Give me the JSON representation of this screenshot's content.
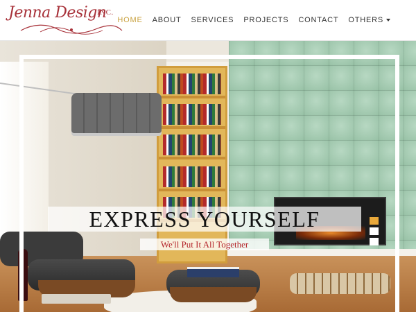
{
  "brand": {
    "name": "Jenna Design",
    "suffix": "INC."
  },
  "nav": {
    "items": [
      {
        "label": "HOME",
        "active": true
      },
      {
        "label": "ABOUT",
        "active": false
      },
      {
        "label": "SERVICES",
        "active": false
      },
      {
        "label": "PROJECTS",
        "active": false
      },
      {
        "label": "CONTACT",
        "active": false
      },
      {
        "label": "OTHERS",
        "active": false,
        "dropdown": true
      }
    ]
  },
  "hero": {
    "headline": "EXPRESS YOURSELF",
    "subheadline": "We'll Put It All Together",
    "slides_total": 3,
    "active_slide": 1
  },
  "colors": {
    "brand_red": "#a8323a",
    "nav_active": "#c9a240",
    "nav_text": "#333333",
    "indicator_active": "#e9a83a",
    "subheadline_red": "#b4242a"
  }
}
